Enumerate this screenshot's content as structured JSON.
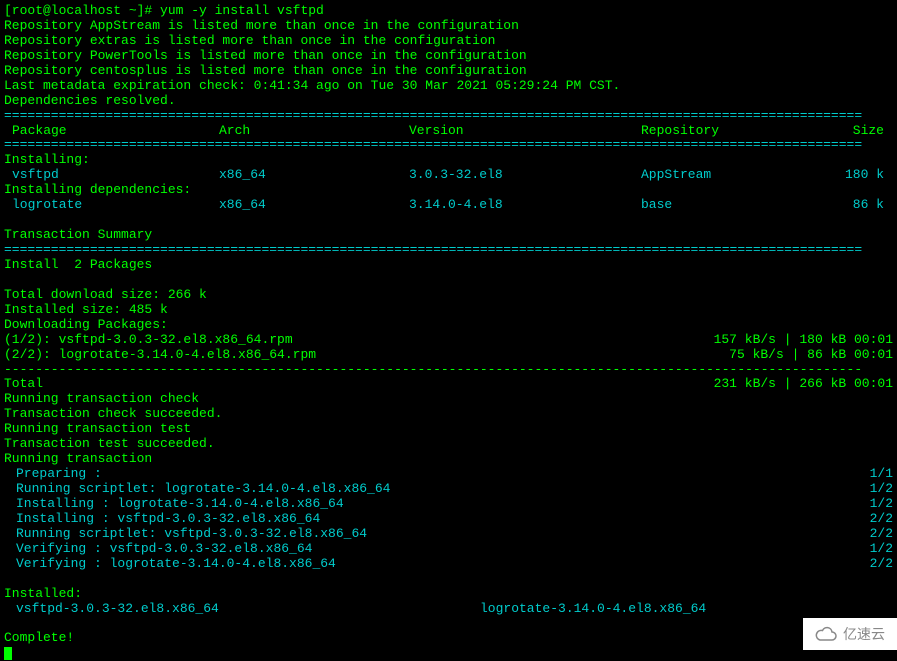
{
  "prompt": "[root@localhost ~]# yum -y install vsftpd",
  "repo_warnings": [
    "Repository AppStream is listed more than once in the configuration",
    "Repository extras is listed more than once in the configuration",
    "Repository PowerTools is listed more than once in the configuration",
    "Repository centosplus is listed more than once in the configuration"
  ],
  "metadata_check": "Last metadata expiration check: 0:41:34 ago on Tue 30 Mar 2021 05:29:24 PM CST.",
  "deps_resolved": "Dependencies resolved.",
  "table": {
    "headers": {
      "package": " Package",
      "arch": "Arch",
      "version": "Version",
      "repository": "Repository",
      "size": "Size"
    },
    "installing_label": "Installing:",
    "installing": [
      {
        "package": "vsftpd",
        "arch": "x86_64",
        "version": "3.0.3-32.el8",
        "repository": "AppStream",
        "size": "180 k"
      }
    ],
    "installing_deps_label": "Installing dependencies:",
    "installing_deps": [
      {
        "package": "logrotate",
        "arch": "x86_64",
        "version": "3.14.0-4.el8",
        "repository": "base",
        "size": "86 k"
      }
    ]
  },
  "transaction_summary": "Transaction Summary",
  "install_count": "Install  2 Packages",
  "totals": {
    "download_size": "Total download size: 266 k",
    "installed_size": "Installed size: 485 k"
  },
  "downloading_label": "Downloading Packages:",
  "downloads": [
    {
      "name": "(1/2): vsftpd-3.0.3-32.el8.x86_64.rpm",
      "stats": "157 kB/s | 180 kB     00:01"
    },
    {
      "name": "(2/2): logrotate-3.14.0-4.el8.x86_64.rpm",
      "stats": " 75 kB/s |  86 kB     00:01"
    }
  ],
  "total_line": {
    "label": "Total",
    "stats": "231 kB/s | 266 kB     00:01"
  },
  "transaction_steps": {
    "check": "Running transaction check",
    "check_ok": "Transaction check succeeded.",
    "test": "Running transaction test",
    "test_ok": "Transaction test succeeded.",
    "running": "Running transaction"
  },
  "steps": [
    {
      "label": "Preparing        :",
      "counter": "1/1"
    },
    {
      "label": "Running scriptlet: logrotate-3.14.0-4.el8.x86_64",
      "counter": "1/2"
    },
    {
      "label": "Installing       : logrotate-3.14.0-4.el8.x86_64",
      "counter": "1/2"
    },
    {
      "label": "Installing       : vsftpd-3.0.3-32.el8.x86_64",
      "counter": "2/2"
    },
    {
      "label": "Running scriptlet: vsftpd-3.0.3-32.el8.x86_64",
      "counter": "2/2"
    },
    {
      "label": "Verifying        : vsftpd-3.0.3-32.el8.x86_64",
      "counter": "1/2"
    },
    {
      "label": "Verifying        : logrotate-3.14.0-4.el8.x86_64",
      "counter": "2/2"
    }
  ],
  "installed_label": "Installed:",
  "installed": {
    "pkg1": "vsftpd-3.0.3-32.el8.x86_64",
    "pkg2": "logrotate-3.14.0-4.el8.x86_64"
  },
  "complete": "Complete!",
  "divider_line": "==============================================================================================================",
  "dash_line": "--------------------------------------------------------------------------------------------------------------",
  "watermark": "亿速云"
}
